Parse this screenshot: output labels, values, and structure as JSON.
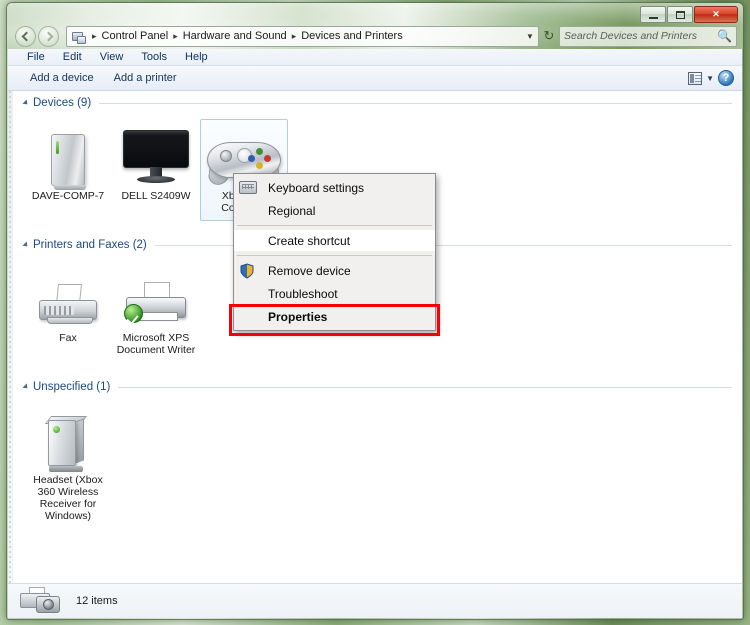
{
  "window": {
    "controls": {
      "minimize": "Minimize",
      "maximize": "Maximize",
      "close": "✕"
    }
  },
  "address": {
    "back_tooltip": "Back",
    "forward_tooltip": "Forward",
    "crumbs": [
      "Control Panel",
      "Hardware and Sound",
      "Devices and Printers"
    ],
    "separator": "▸",
    "dropdown": "▼",
    "refresh": "↻"
  },
  "search": {
    "placeholder": "Search Devices and Printers",
    "icon": "search-icon"
  },
  "menubar": {
    "items": [
      "File",
      "Edit",
      "View",
      "Tools",
      "Help"
    ]
  },
  "toolbar": {
    "buttons": [
      "Add a device",
      "Add a printer"
    ],
    "view_chevron": "▼",
    "help_glyph": "?"
  },
  "sections": [
    {
      "title": "Devices (9)",
      "items": [
        {
          "label": "DAVE-COMP-7",
          "icon": "computer-icon",
          "selected": false
        },
        {
          "label": "DELL S2409W",
          "icon": "monitor-icon",
          "selected": false
        },
        {
          "label": "Xbox 360 Controller",
          "icon": "gamepad-icon",
          "selected": true
        }
      ]
    },
    {
      "title": "Printers and Faxes (2)",
      "items": [
        {
          "label": "Fax",
          "icon": "fax-icon",
          "selected": false
        },
        {
          "label": "Microsoft XPS Document Writer",
          "icon": "printer-default-icon",
          "selected": false
        }
      ]
    },
    {
      "title": "Unspecified (1)",
      "items": [
        {
          "label": "Headset (Xbox 360 Wireless Receiver for Windows)",
          "icon": "device-box-icon",
          "selected": false
        }
      ]
    }
  ],
  "context_menu": {
    "items": [
      {
        "label": "Keyboard settings",
        "icon": "keyboard-icon",
        "hover": false,
        "bold": false
      },
      {
        "label": "Regional",
        "icon": null,
        "hover": false,
        "bold": false
      },
      {
        "label": "Create shortcut",
        "icon": null,
        "hover": true,
        "bold": false
      },
      {
        "label": "Remove device",
        "icon": "shield-icon",
        "hover": false,
        "bold": false
      },
      {
        "label": "Troubleshoot",
        "icon": null,
        "hover": false,
        "bold": false
      },
      {
        "label": "Properties",
        "icon": null,
        "hover": false,
        "bold": true
      }
    ]
  },
  "highlight": {
    "target": "Properties",
    "color": "#f50000"
  },
  "status": {
    "item_count": "12 items",
    "icon": "devices-icon"
  }
}
